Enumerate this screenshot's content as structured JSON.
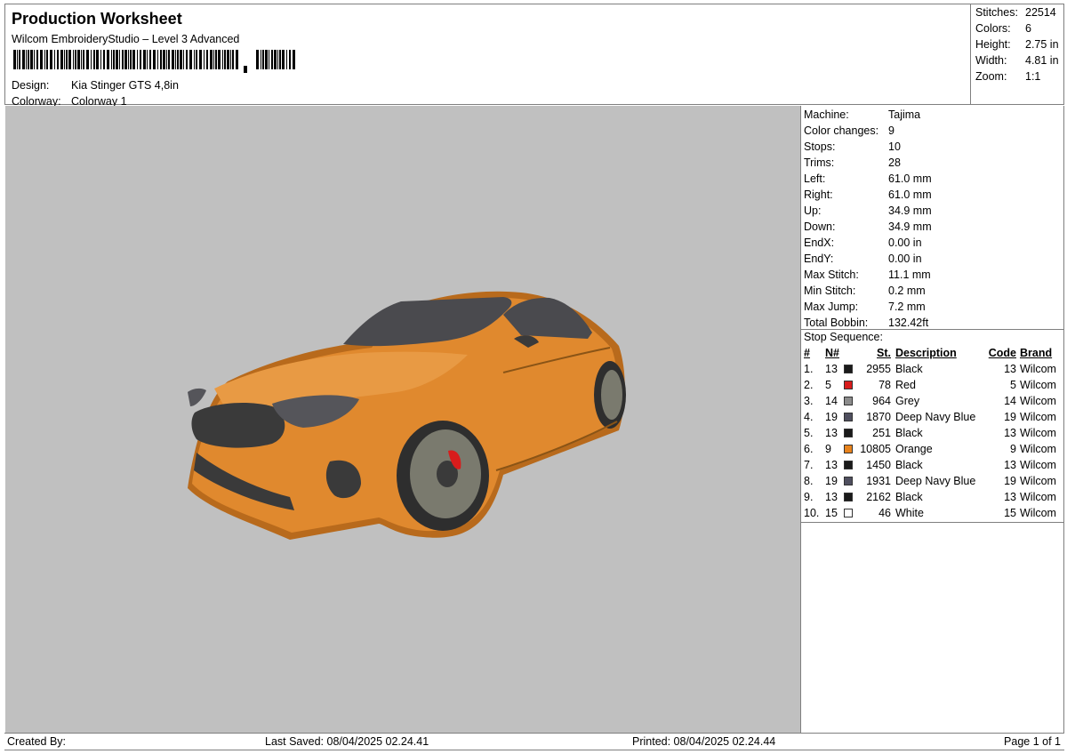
{
  "header": {
    "title": "Production Worksheet",
    "subtitle": "Wilcom EmbroideryStudio – Level 3 Advanced",
    "design_label": "Design:",
    "design_value": "Kia Stinger GTS 4,8in",
    "colorway_label": "Colorway:",
    "colorway_value": "Colorway 1"
  },
  "summary": [
    {
      "label": "Stitches:",
      "value": "22514"
    },
    {
      "label": "Colors:",
      "value": "6"
    },
    {
      "label": "Height:",
      "value": "2.75 in"
    },
    {
      "label": "Width:",
      "value": "4.81 in"
    },
    {
      "label": "Zoom:",
      "value": "1:1"
    }
  ],
  "machine": [
    {
      "label": "Machine:",
      "value": "Tajima"
    },
    {
      "label": "Color changes:",
      "value": "9"
    },
    {
      "label": "Stops:",
      "value": "10"
    },
    {
      "label": "Trims:",
      "value": "28"
    },
    {
      "label": "Left:",
      "value": "61.0 mm"
    },
    {
      "label": "Right:",
      "value": "61.0 mm"
    },
    {
      "label": "Up:",
      "value": "34.9 mm"
    },
    {
      "label": "Down:",
      "value": "34.9 mm"
    },
    {
      "label": "EndX:",
      "value": "0.00 in"
    },
    {
      "label": "EndY:",
      "value": "0.00 in"
    },
    {
      "label": "Max Stitch:",
      "value": "11.1 mm"
    },
    {
      "label": "Min Stitch:",
      "value": "0.2 mm"
    },
    {
      "label": "Max Jump:",
      "value": "7.2 mm"
    },
    {
      "label": "Total Bobbin:",
      "value": "132.42ft"
    }
  ],
  "stop_sequence": {
    "title": "Stop Sequence:",
    "headers": {
      "idx": "#",
      "n": "N#",
      "st": "St.",
      "desc": "Description",
      "code": "Code",
      "brand": "Brand"
    },
    "rows": [
      {
        "idx": "1.",
        "n": "13",
        "color": "#1a1a1a",
        "st": "2955",
        "desc": "Black",
        "code": "13",
        "brand": "Wilcom"
      },
      {
        "idx": "2.",
        "n": "5",
        "color": "#d81c1c",
        "st": "78",
        "desc": "Red",
        "code": "5",
        "brand": "Wilcom"
      },
      {
        "idx": "3.",
        "n": "14",
        "color": "#8c8c8c",
        "st": "964",
        "desc": "Grey",
        "code": "14",
        "brand": "Wilcom"
      },
      {
        "idx": "4.",
        "n": "19",
        "color": "#4f4f5f",
        "st": "1870",
        "desc": "Deep Navy Blue",
        "code": "19",
        "brand": "Wilcom"
      },
      {
        "idx": "5.",
        "n": "13",
        "color": "#1a1a1a",
        "st": "251",
        "desc": "Black",
        "code": "13",
        "brand": "Wilcom"
      },
      {
        "idx": "6.",
        "n": "9",
        "color": "#e8831c",
        "st": "10805",
        "desc": "Orange",
        "code": "9",
        "brand": "Wilcom"
      },
      {
        "idx": "7.",
        "n": "13",
        "color": "#1a1a1a",
        "st": "1450",
        "desc": "Black",
        "code": "13",
        "brand": "Wilcom"
      },
      {
        "idx": "8.",
        "n": "19",
        "color": "#4f4f5f",
        "st": "1931",
        "desc": "Deep Navy Blue",
        "code": "19",
        "brand": "Wilcom"
      },
      {
        "idx": "9.",
        "n": "13",
        "color": "#1a1a1a",
        "st": "2162",
        "desc": "Black",
        "code": "13",
        "brand": "Wilcom"
      },
      {
        "idx": "10.",
        "n": "15",
        "color": "#ffffff",
        "st": "46",
        "desc": "White",
        "code": "15",
        "brand": "Wilcom"
      }
    ]
  },
  "footer": {
    "created_by": "Created By:",
    "last_saved": "Last Saved: 08/04/2025 02.24.41",
    "printed": "Printed: 08/04/2025 02.24.44",
    "page": "Page 1 of 1"
  },
  "colors": {
    "preview_bg": "#c0c0c0",
    "body": "#e0892e",
    "body_dark": "#b86a1c",
    "glass": "#4a4a4e",
    "trim": "#3a3a3a",
    "wheel": "#7a7a6e",
    "caliper": "#d81c1c"
  }
}
